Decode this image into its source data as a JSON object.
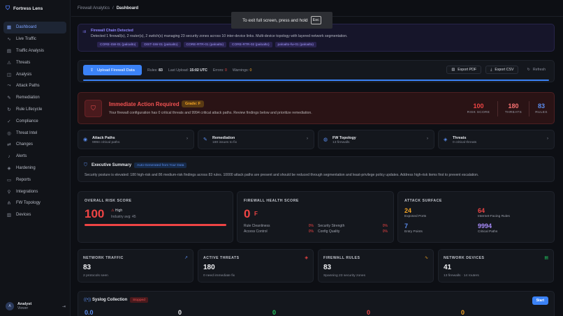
{
  "sidebar": {
    "brand": "Fortress Lens",
    "items": [
      {
        "label": "Dashboard",
        "icon": "grid-icon",
        "glyph": "▦"
      },
      {
        "label": "Live Traffic",
        "icon": "activity-icon",
        "glyph": "∿"
      },
      {
        "label": "Traffic Analysis",
        "icon": "bar-chart-icon",
        "glyph": "▤"
      },
      {
        "label": "Threats",
        "icon": "alert-icon",
        "glyph": "⚠"
      },
      {
        "label": "Analysis",
        "icon": "chart-icon",
        "glyph": "◫"
      },
      {
        "label": "Attack Paths",
        "icon": "path-icon",
        "glyph": "⤳"
      },
      {
        "label": "Remediation",
        "icon": "wrench-icon",
        "glyph": "✎"
      },
      {
        "label": "Rule Lifecycle",
        "icon": "cycle-icon",
        "glyph": "↻"
      },
      {
        "label": "Compliance",
        "icon": "check-icon",
        "glyph": "✓"
      },
      {
        "label": "Threat Intel",
        "icon": "radar-icon",
        "glyph": "◎"
      },
      {
        "label": "Changes",
        "icon": "diff-icon",
        "glyph": "⇄"
      },
      {
        "label": "Alerts",
        "icon": "bell-icon",
        "glyph": "♪"
      },
      {
        "label": "Hardening",
        "icon": "shield-icon",
        "glyph": "◈"
      },
      {
        "label": "Reports",
        "icon": "file-icon",
        "glyph": "▭"
      },
      {
        "label": "Integrations",
        "icon": "plug-icon",
        "glyph": "⚲"
      },
      {
        "label": "FW Topology",
        "icon": "network-icon",
        "glyph": "⋔"
      },
      {
        "label": "Devices",
        "icon": "server-icon",
        "glyph": "▥"
      }
    ],
    "user": {
      "name": "Analyst",
      "role": "Viewer",
      "initials": "A"
    }
  },
  "header": {
    "crumb": "Firewall Analytics",
    "sep": "/",
    "current": "Dashboard"
  },
  "fullscreen": {
    "text": "To exit full screen, press and hold",
    "key": "Esc"
  },
  "chain": {
    "title": "Firewall Chain Detected",
    "desc": "Detected 1 firewall(s), 2 router(s), 2 switch(s) managing 23 security zones across 10 inter-device links. Multi-device topology with layered network segmentation.",
    "tags": [
      "CORE-SW-01 (paloalto)",
      "DIST-SW-01 (paloalto)",
      "CORE-RTR-01 (paloalto)",
      "CORE-RTR-02 (paloalto)",
      "paloalto-fw-01 (paloalto)"
    ]
  },
  "upload": {
    "button": "Upload Firewall Data",
    "rules_label": "Rules:",
    "rules": "83",
    "last_label": "Last Upload:",
    "last": "15:02 UTC",
    "errors_label": "Errors:",
    "errors": "0",
    "warnings_label": "Warnings:",
    "warnings": "0",
    "export_pdf": "Export PDF",
    "export_csv": "Export CSV",
    "refresh": "Refresh"
  },
  "immediate": {
    "title": "Immediate Action Required",
    "grade": "Grade: F",
    "sub": "Your firewall configuration has 0 critical threats and 9994 critical attack paths. Review findings below and prioritize remediation.",
    "risk_value": "100",
    "risk_label": "RISK SCORE",
    "threats_value": "180",
    "threats_label": "THREATS",
    "rules_value": "83",
    "rules_label": "RULES"
  },
  "navcards": [
    {
      "title": "Attack Paths",
      "sub": "9994 critical paths",
      "icon": "target-icon",
      "glyph": "◉"
    },
    {
      "title": "Remediation",
      "sub": "180 issues to fix",
      "icon": "wrench-icon",
      "glyph": "✎"
    },
    {
      "title": "FW Topology",
      "sub": "13 firewalls",
      "icon": "globe-icon",
      "glyph": "◍"
    },
    {
      "title": "Threats",
      "sub": "0 critical threats",
      "icon": "shield-icon",
      "glyph": "◈"
    }
  ],
  "exec": {
    "title": "Executive Summary",
    "badge": "Auto-Generated from Your Data",
    "text": "Security posture is elevated: 180 high-risk and 86 medium-risk findings across 83 rules. 10000 attack paths are present and should be reduced through segmentation and least-privilege policy updates. Address high-risk items first to prevent escalation."
  },
  "risk": {
    "header": "OVERALL RISK SCORE",
    "value": "100",
    "level": "High",
    "avg": "Industry avg: 45",
    "fill_percent": 100
  },
  "health": {
    "header": "FIREWALL HEALTH SCORE",
    "value": "0",
    "grade": "F",
    "rows": [
      {
        "label": "Rule Cleanliness",
        "pct": "0%"
      },
      {
        "label": "Security Strength",
        "pct": "0%"
      },
      {
        "label": "Access Control",
        "pct": "0%"
      },
      {
        "label": "Config Quality",
        "pct": "0%"
      }
    ]
  },
  "surface": {
    "header": "ATTACK SURFACE",
    "cells": [
      {
        "value": "24",
        "label": "Exposed Ports",
        "color": "#f5a524"
      },
      {
        "value": "64",
        "label": "Internet-Facing Rules",
        "color": "#ef4444"
      },
      {
        "value": "7",
        "label": "Entry Points",
        "color": "#5b8def"
      },
      {
        "value": "9994",
        "label": "Critical Paths",
        "color": "#a78bfa"
      }
    ]
  },
  "stats": [
    {
      "header": "NETWORK TRAFFIC",
      "value": "83",
      "sub": "2 protocols seen",
      "icon": "trend-icon",
      "glyph": "↗",
      "color": "#5b8def"
    },
    {
      "header": "ACTIVE THREATS",
      "value": "180",
      "sub": "0 need immediate fix",
      "icon": "shield-icon",
      "glyph": "◈",
      "color": "#ef4444"
    },
    {
      "header": "FIREWALL RULES",
      "value": "83",
      "sub": "Spanning 23 security zones",
      "icon": "pulse-icon",
      "glyph": "∿",
      "color": "#f5a524"
    },
    {
      "header": "NETWORK DEVICES",
      "value": "41",
      "sub": "13 firewalls · 14 routers",
      "icon": "server-icon",
      "glyph": "▤",
      "color": "#22c55e"
    }
  ],
  "syslog": {
    "title": "Syslog Collection",
    "status": "Stopped",
    "start": "Start",
    "values": [
      {
        "v": "0.0",
        "color": "#5b8def"
      },
      {
        "v": "0",
        "color": "#f0f1f4"
      },
      {
        "v": "0",
        "color": "#22c55e"
      },
      {
        "v": "0",
        "color": "#ef4444"
      },
      {
        "v": "0",
        "color": "#f5a524"
      }
    ]
  },
  "colors": {
    "accent": "#3b82f6",
    "danger": "#ef4444",
    "warn": "#f5a524",
    "purple": "#a78bfa",
    "success": "#22c55e"
  }
}
